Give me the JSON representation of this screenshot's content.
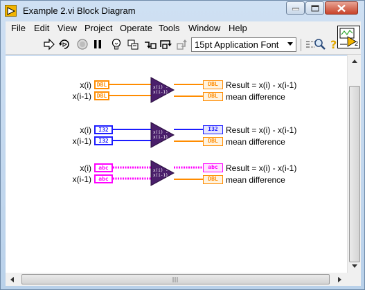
{
  "window": {
    "title": "Example 2.vi Block Diagram",
    "icon": "labview-run-icon",
    "controls": [
      "minimize-icon",
      "maximize-icon",
      "close-icon"
    ]
  },
  "menu": {
    "items": [
      "File",
      "Edit",
      "View",
      "Project",
      "Operate",
      "Tools",
      "Window",
      "Help"
    ]
  },
  "toolbar": {
    "tools": [
      "run-arrow-icon",
      "run-continuously-icon",
      "abort-icon",
      "pause-icon",
      "highlight-execution-icon",
      "retain-wire-values-icon",
      "step-into-icon",
      "step-over-icon",
      "step-out-icon"
    ],
    "font_select": "15pt Application Font",
    "right_tools": [
      "clean-up-icon",
      "search-icon",
      "help-icon"
    ],
    "vi_icon_number": "2"
  },
  "diagram": {
    "groups": [
      {
        "type": "DBL",
        "color": "#ff8c00",
        "input_labels": [
          "x(i)",
          "x(i-1)"
        ],
        "input_terminals": [
          "DBL",
          "DBL"
        ],
        "node_lines": [
          "x(i) -",
          "x(i-1)"
        ],
        "output_labels": [
          "Result = x(i) - x(i-1)",
          "mean difference"
        ],
        "output_terminals": [
          "DBL",
          "DBL"
        ]
      },
      {
        "type": "I32",
        "color": "#1c1cff",
        "input_labels": [
          "x(i)",
          "x(i-1)"
        ],
        "input_terminals": [
          "I32",
          "I32"
        ],
        "node_lines": [
          "x(i) -",
          "x(i-1)"
        ],
        "output_labels": [
          "Result = x(i) - x(i-1)",
          "mean difference"
        ],
        "output_terminals": [
          "I32",
          "DBL"
        ]
      },
      {
        "type": "abc",
        "color": "#ff00ff",
        "input_labels": [
          "x(i)",
          "x(i-1)"
        ],
        "input_terminals": [
          "abc",
          "abc"
        ],
        "node_lines": [
          "x(i) -",
          "x(i-1)"
        ],
        "output_labels": [
          "Result = x(i) - x(i-1)",
          "mean difference"
        ],
        "output_terminals": [
          "abc",
          "DBL"
        ]
      }
    ]
  }
}
